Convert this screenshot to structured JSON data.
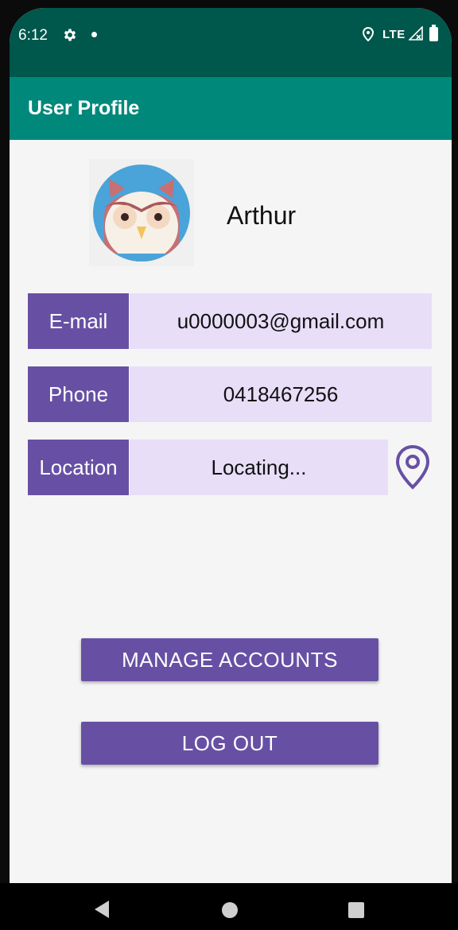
{
  "status_bar": {
    "time": "6:12",
    "network": "LTE",
    "icons": [
      "gear-icon",
      "notification-dot-icon",
      "location-icon",
      "signal-icon",
      "battery-icon"
    ]
  },
  "app_bar": {
    "title": "User Profile"
  },
  "profile": {
    "name": "Arthur",
    "avatar": "owl-avatar"
  },
  "fields": {
    "email": {
      "label": "E-mail",
      "value": "u0000003@gmail.com"
    },
    "phone": {
      "label": "Phone",
      "value": "0418467256"
    },
    "location": {
      "label": "Location",
      "value": "Locating...",
      "action_icon": "map-pin-icon"
    }
  },
  "buttons": {
    "manage_accounts": "MANAGE ACCOUNTS",
    "log_out": "LOG OUT"
  },
  "colors": {
    "status_bar": "#00574b",
    "app_bar": "#00897b",
    "label_bg": "#6750a4",
    "value_bg": "#e8def8",
    "background": "#f5f5f5"
  },
  "nav_bar": {
    "icons": [
      "back-icon",
      "home-icon",
      "recents-icon"
    ]
  }
}
